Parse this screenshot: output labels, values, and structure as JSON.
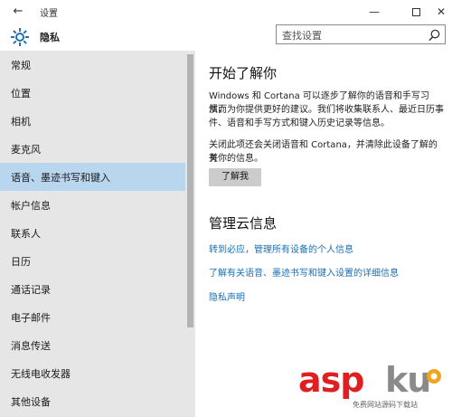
{
  "titlebar": {
    "back_glyph": "←",
    "title": "设置",
    "minimize_glyph": "—",
    "close_glyph": "✕"
  },
  "header": {
    "title": "隐私",
    "icon": "gear-icon"
  },
  "search": {
    "placeholder": "查找设置",
    "icon": "search-icon"
  },
  "sidebar": {
    "items": [
      {
        "label": "常规",
        "selected": false
      },
      {
        "label": "位置",
        "selected": false
      },
      {
        "label": "相机",
        "selected": false
      },
      {
        "label": "麦克风",
        "selected": false
      },
      {
        "label": "语音、墨迹书写和键入",
        "selected": true
      },
      {
        "label": "帐户信息",
        "selected": false
      },
      {
        "label": "联系人",
        "selected": false
      },
      {
        "label": "日历",
        "selected": false
      },
      {
        "label": "通话记录",
        "selected": false
      },
      {
        "label": "电子邮件",
        "selected": false
      },
      {
        "label": "消息传送",
        "selected": false
      },
      {
        "label": "无线电收发器",
        "selected": false
      },
      {
        "label": "其他设备",
        "selected": false
      }
    ],
    "selected_color": "#b8d6ee"
  },
  "content": {
    "section1_title": "开始了解你",
    "intro_line1": "Windows 和 Cortana 可以逐步了解你的语音和手写习惯，",
    "intro_line2": "从而为你提供更好的建议。我们将收集联系人、最近日历事",
    "intro_line3": "件、语音和手写方式和键入历史记录等信息。",
    "notice_line1": "关闭此项还会关闭语音和 Cortana，并清除此设备了解的有",
    "notice_line2": "关你的信息。",
    "button_label": "了解我",
    "section2_title": "管理云信息",
    "link1": "转到必应，管理所有设备的个人信息",
    "link2": "了解有关语音、墨迹书写和键入设置的详细信息",
    "link3": "隐私声明",
    "link_color": "#1a6fb5"
  },
  "watermark": {
    "brand_red": "asp",
    "brand_gray": "ku",
    "sub": "免费网站源码下载站"
  }
}
